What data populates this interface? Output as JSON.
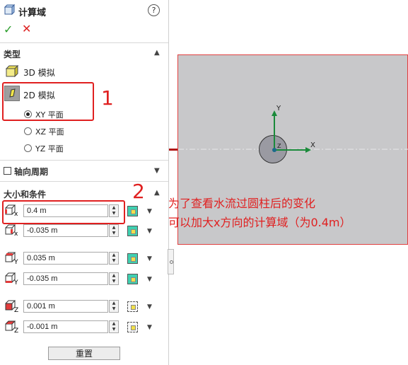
{
  "panel": {
    "title": "计算域",
    "help": "?",
    "ok": "✓",
    "cancel": "✕"
  },
  "type_section": {
    "title": "类型",
    "sim3d": "3D 模拟",
    "sim2d": "2D 模拟",
    "planes": [
      "XY 平面",
      "XZ 平面",
      "YZ 平面"
    ],
    "selected_plane": "XY 平面"
  },
  "axial_section": {
    "title": "轴向周期"
  },
  "size_section": {
    "title": "大小和条件",
    "fields": [
      {
        "axis": "x",
        "value": "0.4 m"
      },
      {
        "axis": "x",
        "value": "-0.035 m"
      },
      {
        "axis": "Y",
        "value": "0.035 m"
      },
      {
        "axis": "Y",
        "value": "-0.035 m"
      },
      {
        "axis": "Z",
        "value": "0.001 m"
      },
      {
        "axis": "Z",
        "value": "-0.001 m"
      }
    ],
    "reset": "重置"
  },
  "annotations": {
    "label1": "1",
    "label2": "2",
    "note_line1": "为了查看水流过圆柱后的变化",
    "note_line2": "可以加大x方向的计算域（为0.4m）",
    "color": "#e02020"
  },
  "viewport": {
    "axis_x": "X",
    "axis_y": "Y",
    "axis_z": "Z",
    "domain_color": "#c8c8ca"
  }
}
